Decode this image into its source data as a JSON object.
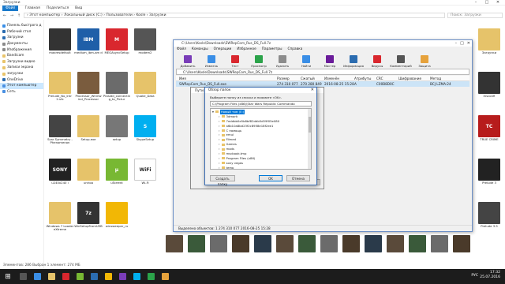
{
  "explorer": {
    "title": "Загрузки",
    "ribbon_tabs": [
      "Файл",
      "Главная",
      "Поделиться",
      "Вид"
    ],
    "address": "› Этот компьютер › Локальный диск (C:) › Пользователи › Kosle › Загрузки",
    "search_placeholder": "Поиск: Загрузки",
    "status": "Элементов: 286   Выбран 1 элемент: 274 МБ"
  },
  "sidebar": {
    "items": [
      {
        "label": "Панель быстрого д",
        "color": "#3a8ee6"
      },
      {
        "label": "Рабочий стол",
        "color": "#2b6cb0"
      },
      {
        "label": "Загрузки",
        "color": "#2b6cb0"
      },
      {
        "label": "Документы",
        "color": "#8a8a8a"
      },
      {
        "label": "Изображения",
        "color": "#8a8a8a"
      },
      {
        "label": "Bandicam",
        "color": "#e9c46a"
      },
      {
        "label": "Загрузки видео",
        "color": "#e9c46a"
      },
      {
        "label": "Записи экрана",
        "color": "#e9c46a"
      },
      {
        "label": "загрузки",
        "color": "#e9c46a"
      },
      {
        "label": "OneDrive",
        "color": "#2b6cb0"
      },
      {
        "label": "Этот компьютер",
        "color": "#4a90e2"
      },
      {
        "label": "Сеть",
        "color": "#4a90e2"
      }
    ],
    "selected_index": 10
  },
  "files": [
    {
      "label": "maxresdefault",
      "color": "#333",
      "glyph": ""
    },
    {
      "label": "medium_ibm-am d",
      "color": "#1f5fa8",
      "glyph": "IBM"
    },
    {
      "label": "MEGAsyncSetup",
      "color": "#d9272e",
      "glyph": "M"
    },
    {
      "label": "modem2",
      "color": "#555",
      "glyph": ""
    },
    {
      "label": "Prelude_No_Intr 2.sfx",
      "color": "#e6c36a",
      "glyph": ""
    },
    {
      "label": "Processor_Whirlw ind_Processor",
      "color": "#7a5c3e",
      "glyph": ""
    },
    {
      "label": "Prosidd_connectin g_to_Pictur",
      "color": "#6b6b6b",
      "glyph": ""
    },
    {
      "label": "Quake_Data",
      "color": "#e6c36a",
      "glyph": ""
    },
    {
      "label": "Scar Symmetry - Phenomenon",
      "color": "#444",
      "glyph": ""
    },
    {
      "label": "Setup.exe",
      "color": "#e6c36a",
      "glyph": ""
    },
    {
      "label": "setup",
      "color": "#777",
      "glyph": ""
    },
    {
      "label": "SkypeSetup",
      "color": "#00aff0",
      "glyph": "S"
    },
    {
      "label": "u240x240 i",
      "color": "#222",
      "glyph": "SONY"
    },
    {
      "label": "unrioo",
      "color": "#e6c36a",
      "glyph": ""
    },
    {
      "label": "uTorrent",
      "color": "#78b833",
      "glyph": "µ"
    },
    {
      "label": "Wi-Fi",
      "color": "#fff",
      "glyph": "WiFi"
    },
    {
      "label": "Windows 7 Loader eXtreme",
      "color": "#e6c36a",
      "glyph": ""
    },
    {
      "label": "WinSetupFromUSB",
      "color": "#333",
      "glyph": "7z"
    },
    {
      "label": "winsweeper_ru",
      "color": "#f2b705",
      "glyph": ""
    }
  ],
  "right_column": [
    {
      "label": "Загрузки",
      "color": "#e6c36a",
      "glyph": ""
    },
    {
      "label": "msconfi",
      "color": "#333",
      "glyph": ""
    },
    {
      "label": "TRUE CRIME",
      "color": "#b71c1c",
      "glyph": "TC"
    },
    {
      "label": "Prelude 3",
      "color": "#222",
      "glyph": ""
    },
    {
      "label": "Prelude 3.5",
      "color": "#444",
      "glyph": ""
    }
  ],
  "winrar": {
    "title": "C:\\Users\\Kosle\\Downloads\\SWRepCom_Rus_DS_Full.7z",
    "menu": [
      "Файл",
      "Команды",
      "Операции",
      "Избранное",
      "Параметры",
      "Справка"
    ],
    "toolbar": [
      {
        "label": "Добавить",
        "color": "#7a3db8"
      },
      {
        "label": "Извлечь",
        "color": "#3a8ee6"
      },
      {
        "label": "Тест",
        "color": "#d9272e"
      },
      {
        "label": "Просмотр",
        "color": "#2ba34a"
      },
      {
        "label": "Удалить",
        "color": "#8c8c8c"
      },
      {
        "label": "Найти",
        "color": "#3a8ee6"
      },
      {
        "label": "Мастер",
        "color": "#6a1b9a"
      },
      {
        "label": "Информация",
        "color": "#2b6cb0"
      },
      {
        "label": "Вирусы",
        "color": "#d9272e"
      },
      {
        "label": "Комментарий",
        "color": "#555"
      },
      {
        "label": "Защита",
        "color": "#e6a23c"
      }
    ],
    "path": "C:\\Users\\Kosle\\Downloads\\SWRepCom_Rus_DS_Full.7z",
    "headers": [
      "Имя",
      "Размер",
      "Сжатый",
      "Изменён",
      "Атрибуты",
      "CRC",
      "Шифрование",
      "Метод"
    ],
    "row": [
      "SWRepCom_Rus_DS_Full.exe",
      "274 310 077",
      "270 280 849",
      "2016-08-25 15:28",
      "A",
      "C00B8D0C",
      "",
      "BCJ LZMA:24"
    ],
    "status": "Выделено объектов: 1     274 310 077     2016-08-25 15:28"
  },
  "extract_dialog": {
    "title": "Пути и параметры извлечения",
    "buttons": [
      "OK",
      "Отмена",
      "Справка"
    ]
  },
  "browse_dialog": {
    "title": "Обзор папок",
    "prompt": "Выберите папку из списка и нажмите «OK».",
    "path": "C:\\Program Files (x86)\\Star Wars Republic Commando",
    "tree": [
      {
        "label": "Новый том (E:)",
        "indent": 0,
        "selected": true
      },
      {
        "label": "3dmark",
        "indent": 1
      },
      {
        "label": "7eddbb0e5b8bf82ddb5d59f05e080",
        "indent": 1
      },
      {
        "label": "a6b10a8bd23f2c8958e18f2ee1",
        "indent": 1
      },
      {
        "label": "C помощь",
        "indent": 1
      },
      {
        "label": "emul",
        "indent": 1
      },
      {
        "label": "Filmed",
        "indent": 1
      },
      {
        "label": "Games",
        "indent": 1
      },
      {
        "label": "mods",
        "indent": 1
      },
      {
        "label": "mscbook.tmp",
        "indent": 1
      },
      {
        "label": "Program Files (x86)",
        "indent": 1
      },
      {
        "label": "sony vegas",
        "indent": 1
      },
      {
        "label": "temp",
        "indent": 1
      }
    ],
    "buttons": {
      "new_folder": "Создать папку",
      "ok": "OK",
      "cancel": "Отмена"
    }
  },
  "taskbar": {
    "lang": "РУС",
    "time": "17:32",
    "date": "25.07.2016",
    "icons": [
      "#555",
      "#3a8ee6",
      "#e6c36a",
      "#d9272e",
      "#78b833",
      "#2b6cb0",
      "#f2b705",
      "#7a3db8",
      "#00aff0",
      "#2ba34a",
      "#e6a23c"
    ]
  }
}
